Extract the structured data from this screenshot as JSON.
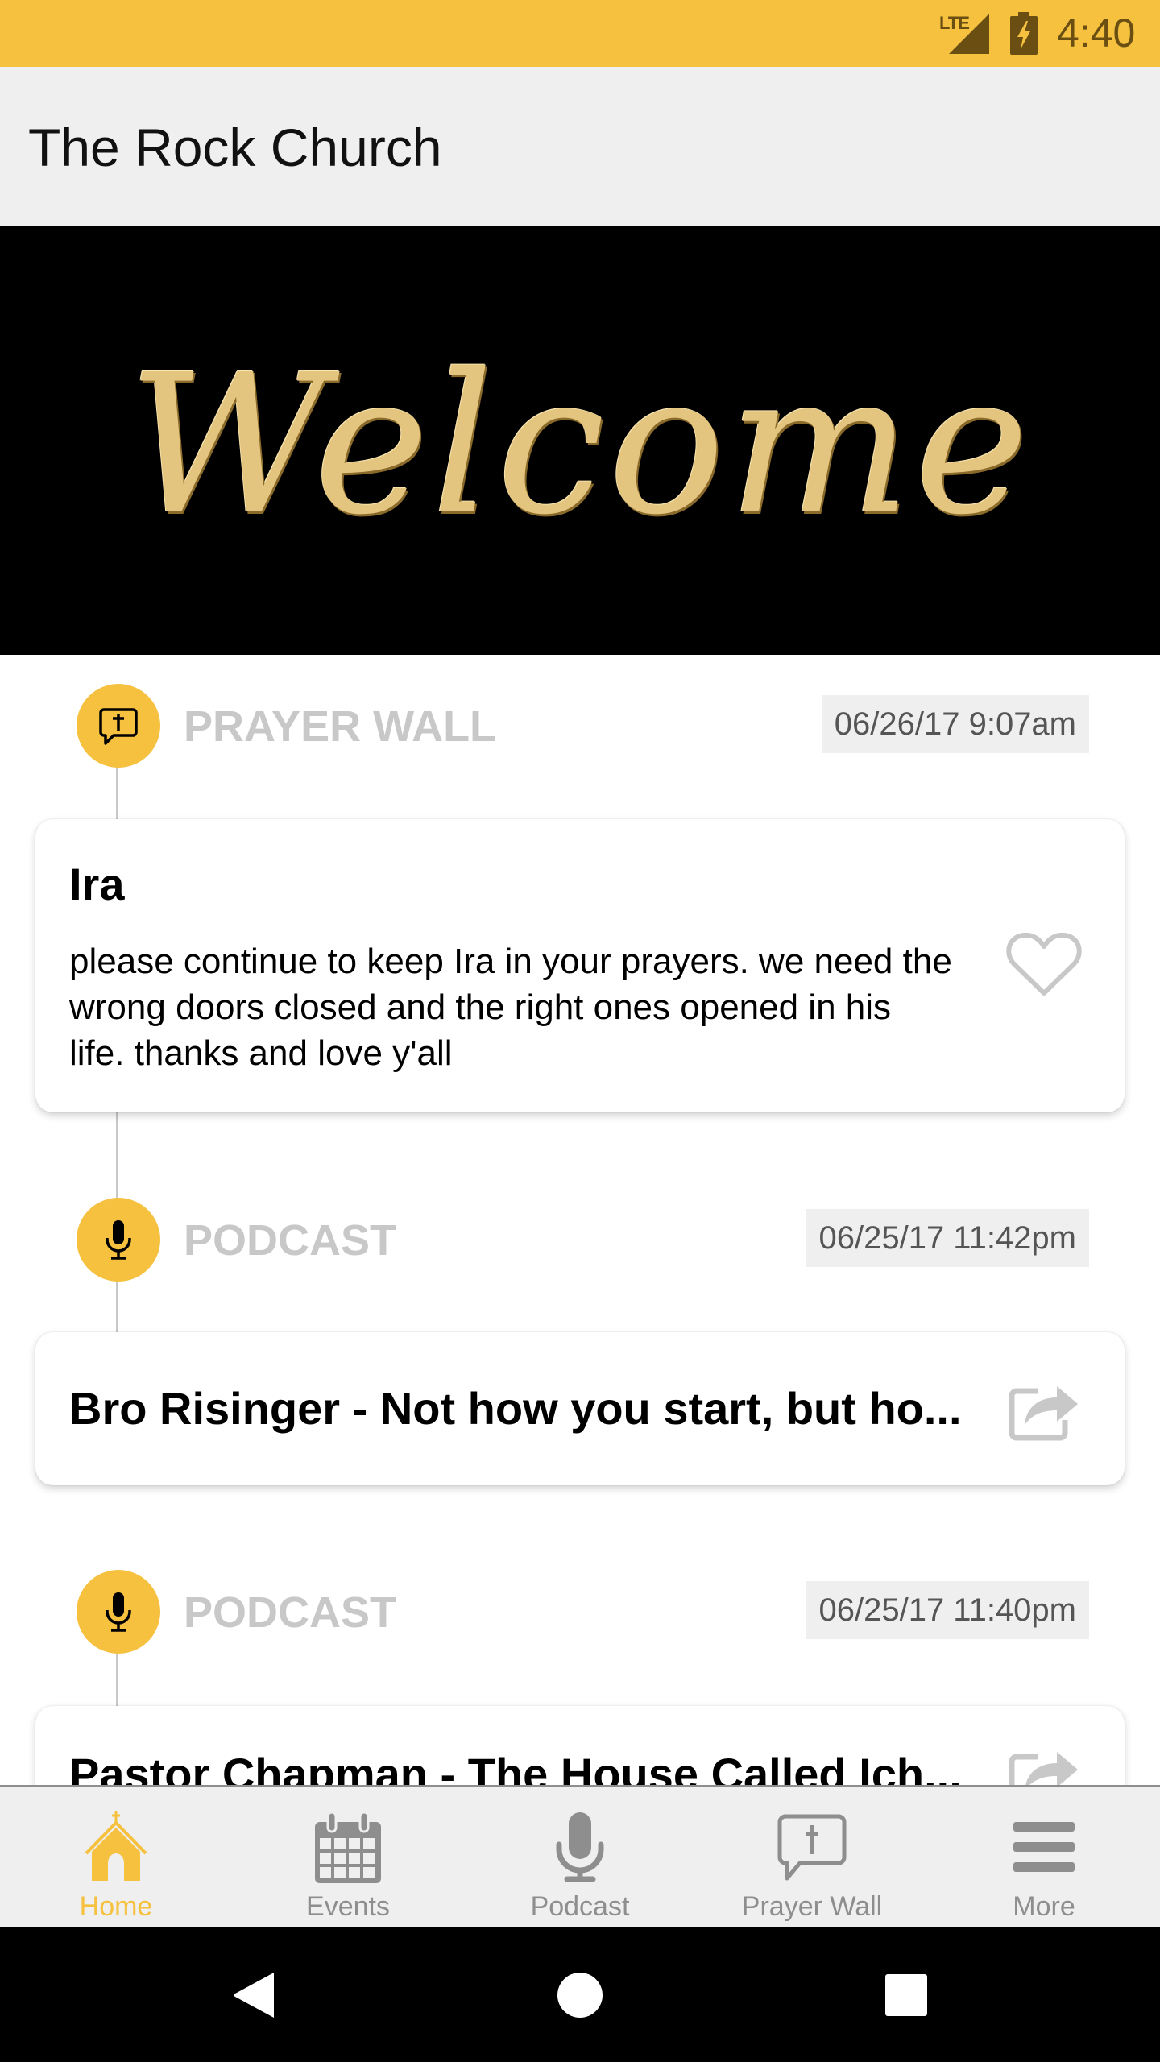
{
  "status_bar": {
    "network": "LTE",
    "time": "4:40",
    "icons": [
      "signal-icon",
      "battery-charging-icon"
    ]
  },
  "app_bar": {
    "title": "The Rock Church"
  },
  "banner": {
    "text": "Welcome"
  },
  "feed": {
    "items": [
      {
        "type": "PRAYER WALL",
        "icon": "prayer-wall-icon",
        "timestamp": "06/26/17 9:07am",
        "name": "Ira",
        "body": "please continue to keep Ira in your prayers. we need the wrong doors closed and the right ones opened in his life. thanks and love y'all",
        "action_icon": "heart-icon"
      },
      {
        "type": "PODCAST",
        "icon": "microphone-icon",
        "timestamp": "06/25/17 11:42pm",
        "title": "Bro Risinger - Not how you start, but ho...",
        "action_icon": "share-icon"
      },
      {
        "type": "PODCAST",
        "icon": "microphone-icon",
        "timestamp": "06/25/17 11:40pm",
        "title": "Pastor Chapman - The House Called Ich...",
        "action_icon": "share-icon"
      }
    ]
  },
  "bottom_nav": {
    "items": [
      {
        "label": "Home",
        "icon": "church-icon",
        "active": true
      },
      {
        "label": "Events",
        "icon": "calendar-icon",
        "active": false
      },
      {
        "label": "Podcast",
        "icon": "microphone-icon",
        "active": false
      },
      {
        "label": "Prayer Wall",
        "icon": "prayer-wall-icon",
        "active": false
      },
      {
        "label": "More",
        "icon": "menu-icon",
        "active": false
      }
    ]
  },
  "system_nav": {
    "buttons": [
      "back",
      "home",
      "recents"
    ]
  },
  "colors": {
    "accent": "#F5C13F",
    "inactive": "#8E8E8E",
    "label_gray": "#C8C8C8",
    "status_icon": "#6A4E12"
  }
}
